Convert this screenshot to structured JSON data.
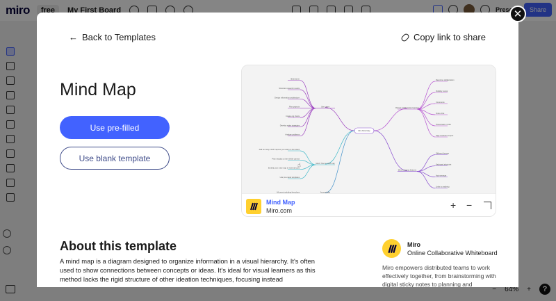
{
  "app": {
    "logo": "miro",
    "plan": "free",
    "board_name": "My First Board",
    "present_label": "Present",
    "share_label": "Share",
    "zoom_level": "64%",
    "help_label": "?"
  },
  "modal": {
    "back_label": "Back to Templates",
    "copy_link_label": "Copy link to share",
    "title": "Mind Map",
    "use_prefilled_label": "Use pre-filled",
    "use_blank_label": "Use blank template",
    "close_glyph": "✕"
  },
  "preview": {
    "embed_title": "Mind Map",
    "embed_source": "Miro.com",
    "zoom_in": "+",
    "zoom_out": "−",
    "mindmap": {
      "center": "Miro Mind Map",
      "left_branches": [
        {
          "label": "Use cases",
          "color": "#9b3fbf",
          "leaves": [
            "Brainstorm",
            "Structure research results",
            "Design information architecture",
            "Plan projects",
            "Create org charts",
            "Develop sales strategies",
            "Analyze problems"
          ]
        },
        {
          "label": "Much Than a mind map",
          "color": "#3fb8c9",
          "leaves": [
            "Add as many mind maps as you want on the board",
            "Plan visually on the infinite canvas",
            "Embed your mind map in external tools",
            "Use pre-made templates"
          ]
        },
        {
          "label": "Accessibility",
          "color": "#3f8fc9",
          "leaves": [
            "All users including free plans"
          ]
        }
      ],
      "right_branches": [
        {
          "label": "Robust collaboration features",
          "color": "#b44fd0",
          "leaves": [
            "Real-time collaboration",
            "Visibility cursor",
            "Comments",
            "Video chat",
            "Presentation mode",
            "High resolution export"
          ]
        },
        {
          "label": "Mind mapping features",
          "color": "#8a4fd0",
          "leaves": [
            "Different themes",
            "Keyboard shortcuts",
            "Auto-arrange",
            "Links to anything"
          ]
        }
      ]
    }
  },
  "about": {
    "heading": "About this template",
    "text": "A mind map is a diagram designed to organize information in a visual hierarchy. It's often used to show connections between concepts or ideas. It's ideal for visual learners as this method lacks the rigid structure of other ideation techniques, focusing instead"
  },
  "author": {
    "name": "Miro",
    "role": "Online Collaborative Whiteboard",
    "description": "Miro empowers distributed teams to work effectively together, from brainstorming with digital sticky notes to planning and"
  }
}
